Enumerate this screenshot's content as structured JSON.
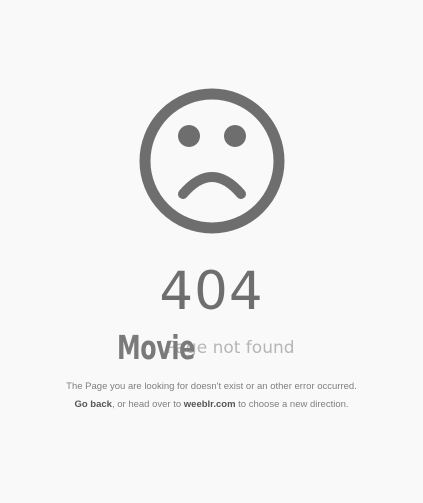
{
  "error": {
    "code": "404",
    "overlay_text": "Movie",
    "faded_title_prefix": "Page",
    "faded_title_suffix": "not found",
    "message_line1": "The Page you are looking for doesn't exist or an other error occurred.",
    "go_back_link": "Go back",
    "message_line2_middle": ", or head over to ",
    "site_link": "weeblr.com",
    "message_line2_end": " to choose a new direction."
  },
  "icon": {
    "name": "sad-face-icon",
    "color": "#6e6e6e"
  },
  "colors": {
    "background": "#f9f9f9",
    "code": "#6e6e6e",
    "overlay": "#7a7a7a",
    "faded": "#b6b6b6",
    "message": "#7f7f7f",
    "link": "#555555"
  }
}
